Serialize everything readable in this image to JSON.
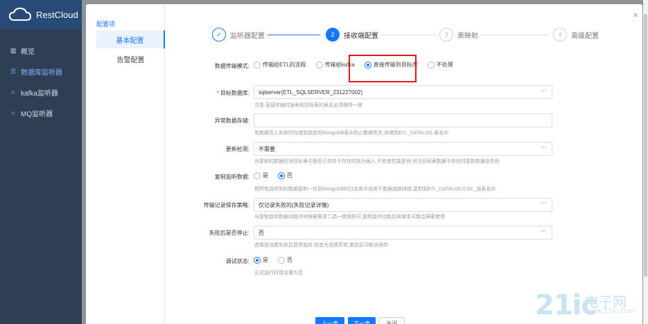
{
  "app": {
    "name": "RestCloud",
    "nav": [
      {
        "icon": "chart-icon",
        "label": "概览"
      },
      {
        "icon": "list-icon",
        "label": "数据库监听器"
      },
      {
        "icon": "headset-icon",
        "label": "kafka监听器"
      },
      {
        "icon": "headset-icon",
        "label": "MQ监听器"
      }
    ]
  },
  "modal": {
    "close": "×",
    "menu_group": "配置项",
    "menu": [
      "基本配置",
      "告警配置"
    ],
    "steps": [
      {
        "num": "✓",
        "label": "监听器配置"
      },
      {
        "num": "2",
        "label": "接收端配置"
      },
      {
        "num": "3",
        "label": "表映射"
      },
      {
        "num": "4",
        "label": "高级配置"
      }
    ]
  },
  "form": {
    "mode": {
      "label": "数据传输模式:",
      "options": [
        "传输给ETL的流程",
        "传输给kafka",
        "直接传输到目标库",
        "不处理"
      ]
    },
    "target_db": {
      "label": "目标数据库:",
      "value": "sqlserver(ETL_SQLSERVER_231227002)",
      "hint": "注意:直接传输时源表和目标表的表名必须保持一致"
    },
    "exception_store": {
      "label": "异常数据存储:",
      "value": "",
      "hint": "有数据写入失败时存储到指定的MongoDB表中防止数据丢失,存储到ETL_DATALOG.表名中"
    },
    "update_check": {
      "label": "更新检测:",
      "value": "不需要",
      "hint": "对更新的数据检测目标表中是否已存在不存在时改为插入,不检查性能更快,但当目标表数据不存在时更新数据会失败"
    },
    "copy_listen": {
      "label": "复制监听数据:",
      "options": [
        "是",
        "否"
      ],
      "hint": "把所有监听到的数据复制一份到MongoDB的日志库中适用于数据追踪排错,复制到ETL_DATALOG.CDC_源表名中"
    },
    "log_strategy": {
      "label": "传输记录保存策略:",
      "value": "仅记录失败的(失败记录详情)",
      "hint": "与复制监听数据功能冲突根据需求二选一使用即可,复制监听功能后续版本可能会屏蔽使用"
    },
    "stop_on_fail": {
      "label": "失败后是否停止:",
      "value": "否",
      "hint": "选择是消费失败后暂停监听,状态为消费异常,重启后可断点续传"
    },
    "debug": {
      "label": "调试状态:",
      "options": [
        "是",
        "否"
      ],
      "hint": "正式运行时请设置为否"
    }
  },
  "footer": {
    "prev": "上一步",
    "next": "下一步",
    "close": "关闭"
  },
  "watermark": {
    "big": "21ic",
    "cn": "电子网",
    "url": "www.21ic.com"
  }
}
